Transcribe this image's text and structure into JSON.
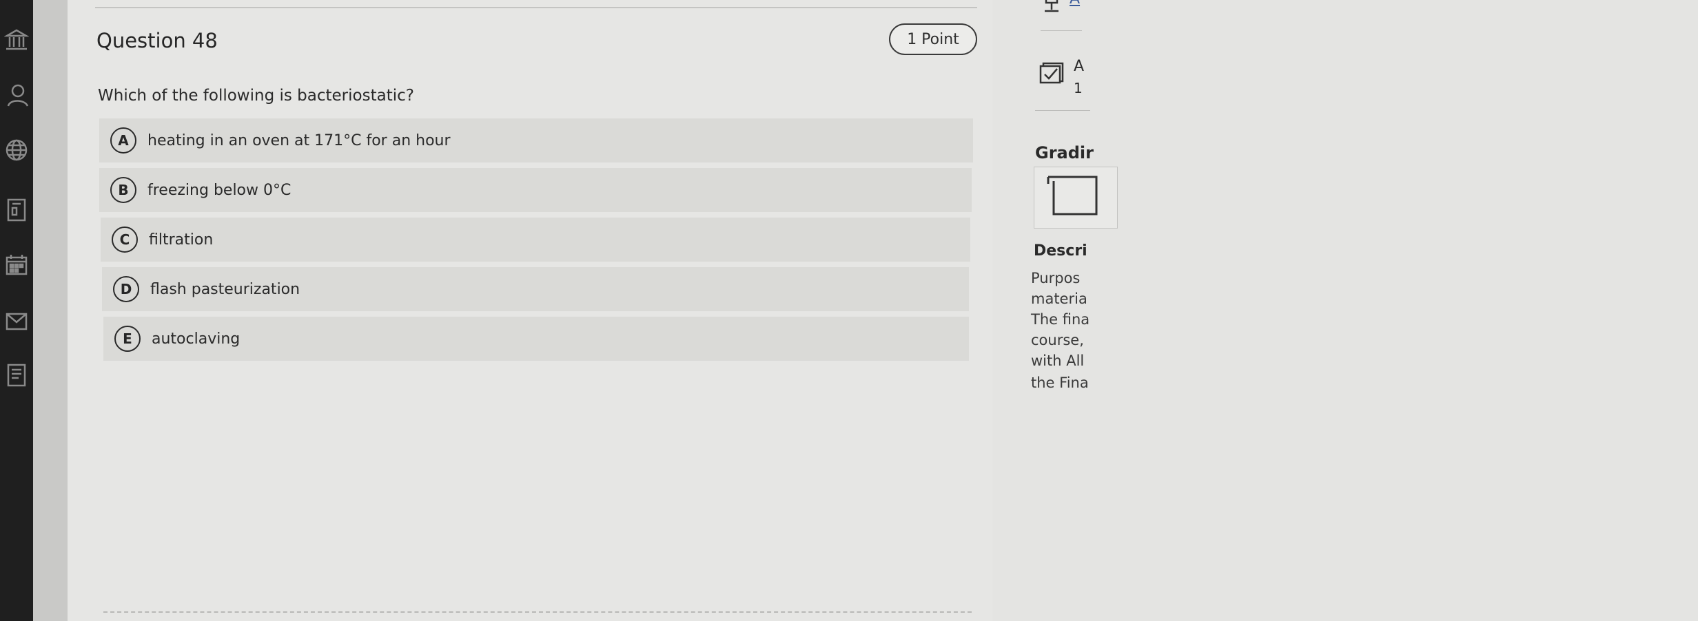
{
  "question": {
    "title": "Question 48",
    "points": "1 Point",
    "prompt": "Which of the following is bacteriostatic?",
    "choices": [
      {
        "letter": "A",
        "text": "heating in an oven at 171°C for an hour"
      },
      {
        "letter": "B",
        "text": "freezing below 0°C"
      },
      {
        "letter": "C",
        "text": "filtration"
      },
      {
        "letter": "D",
        "text": "flash pasteurization"
      },
      {
        "letter": "E",
        "text": "autoclaving"
      }
    ]
  },
  "nav": {
    "icons": [
      "institution-icon",
      "profile-icon",
      "globe-icon",
      "courses-icon",
      "calendar-icon",
      "messages-icon",
      "grades-icon"
    ]
  },
  "side": {
    "top_letter": "A",
    "item_letter": "A",
    "item_number": "1",
    "grading": "Gradir",
    "description_title": "Descri",
    "description_lines": [
      "Purpos",
      "materia",
      "The fina",
      "course,",
      "with All",
      "the Fina"
    ]
  }
}
